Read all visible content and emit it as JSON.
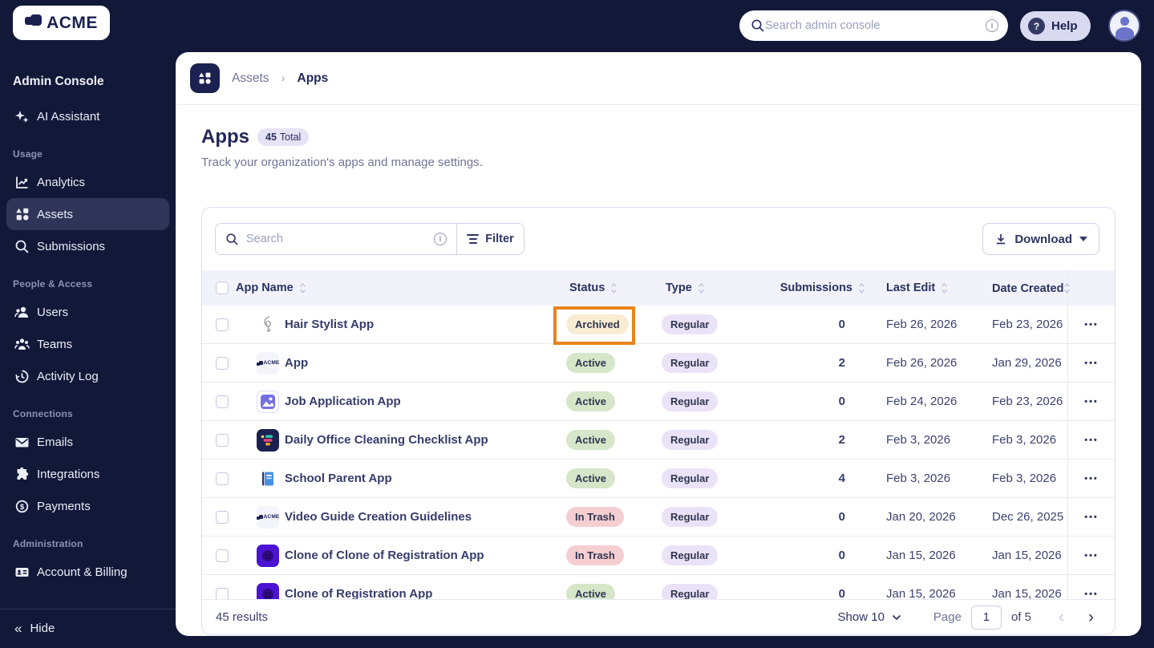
{
  "colors": {
    "brand_navy": "#1b2150",
    "background_navy": "#111838",
    "highlight_orange": "#e8831d",
    "status_archived_bg": "#f9ecd2",
    "status_active_bg": "#d5e6c9",
    "status_in_trash_bg": "#f5ced1",
    "type_regular_bg": "#eae3f8"
  },
  "topbar": {
    "logo_text": "ACME",
    "search_placeholder": "Search admin console",
    "help_label": "Help"
  },
  "sidebar": {
    "title": "Admin Console",
    "assistant": {
      "label": "AI Assistant",
      "icon": "sparkles-icon"
    },
    "sections": [
      {
        "label": "Usage",
        "items": [
          {
            "label": "Analytics",
            "icon": "analytics-icon"
          },
          {
            "label": "Assets",
            "icon": "assets-icon",
            "active": true
          },
          {
            "label": "Submissions",
            "icon": "search-icon"
          }
        ]
      },
      {
        "label": "People & Access",
        "items": [
          {
            "label": "Users",
            "icon": "user-icon"
          },
          {
            "label": "Teams",
            "icon": "team-icon"
          },
          {
            "label": "Activity Log",
            "icon": "history-clock-icon"
          }
        ]
      },
      {
        "label": "Connections",
        "items": [
          {
            "label": "Emails",
            "icon": "envelope-icon"
          },
          {
            "label": "Integrations",
            "icon": "puzzle-icon"
          },
          {
            "label": "Payments",
            "icon": "dollar-circle-icon"
          }
        ]
      },
      {
        "label": "Administration",
        "items": [
          {
            "label": "Account & Billing",
            "icon": "id-card-icon"
          }
        ]
      }
    ],
    "hide_label": "Hide"
  },
  "breadcrumb": {
    "parent": "Assets",
    "current": "Apps"
  },
  "page": {
    "title": "Apps",
    "total_count": "45",
    "total_label": "Total",
    "subtitle": "Track your organization's apps and manage settings."
  },
  "toolbar": {
    "search_placeholder": "Search",
    "filter_label": "Filter",
    "download_label": "Download"
  },
  "table": {
    "headers": {
      "name": "App Name",
      "status": "Status",
      "type": "Type",
      "submissions": "Submissions",
      "last_edit": "Last Edit",
      "date_created": "Date Created"
    },
    "rows": [
      {
        "name": "Hair Stylist App",
        "icon": "hair-swirl-icon",
        "status": "Archived",
        "type": "Regular",
        "submissions": "0",
        "last_edit": "Feb 26, 2026",
        "date_created": "Feb 23, 2026",
        "highlighted": true
      },
      {
        "name": "App",
        "icon": "acme-logo-icon",
        "status": "Active",
        "type": "Regular",
        "submissions": "2",
        "last_edit": "Feb 26, 2026",
        "date_created": "Jan 29, 2026"
      },
      {
        "name": "Job Application App",
        "icon": "photo-person-icon",
        "status": "Active",
        "type": "Regular",
        "submissions": "0",
        "last_edit": "Feb 24, 2026",
        "date_created": "Feb 23, 2026"
      },
      {
        "name": "Daily Office Cleaning Checklist App",
        "icon": "checklist-bars-icon",
        "status": "Active",
        "type": "Regular",
        "submissions": "2",
        "last_edit": "Feb 3, 2026",
        "date_created": "Feb 3, 2026"
      },
      {
        "name": "School Parent App",
        "icon": "book-icon",
        "status": "Active",
        "type": "Regular",
        "submissions": "4",
        "last_edit": "Feb 3, 2026",
        "date_created": "Feb 3, 2026"
      },
      {
        "name": "Video Guide Creation Guidelines",
        "icon": "acme-logo-icon",
        "status": "In Trash",
        "type": "Regular",
        "submissions": "0",
        "last_edit": "Jan 20, 2026",
        "date_created": "Dec 26, 2025"
      },
      {
        "name": "Clone of Clone of Registration App",
        "icon": "robot-face-icon",
        "status": "In Trash",
        "type": "Regular",
        "submissions": "0",
        "last_edit": "Jan 15, 2026",
        "date_created": "Jan 15, 2026"
      },
      {
        "name": "Clone of Registration App",
        "icon": "robot-face-icon",
        "status": "Active",
        "type": "Regular",
        "submissions": "0",
        "last_edit": "Jan 15, 2026",
        "date_created": "Jan 15, 2026"
      }
    ]
  },
  "footer": {
    "results": "45 results",
    "show_label": "Show 10",
    "page_label": "Page",
    "page_value": "1",
    "of_label": "of 5"
  }
}
